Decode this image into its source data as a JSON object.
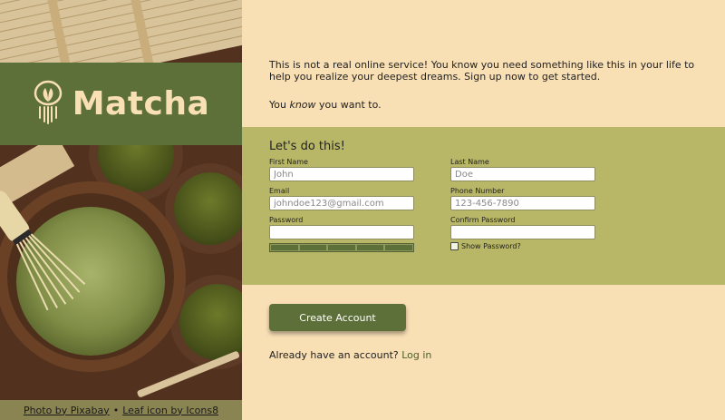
{
  "colors": {
    "page_bg": "#f9dfb4",
    "brand_green": "#5e703a",
    "form_band": "#b8b767",
    "credits_bar": "#8a8352"
  },
  "brand": {
    "name": "Matcha",
    "icon": "matcha-leaf-icon"
  },
  "credits": {
    "photo_link": "Photo by Pixabay",
    "separator": "•",
    "icon_link": "Leaf icon by Icons8"
  },
  "intro": {
    "line1": "This is not a real online service! You know you need something like this in your life to help you realize your deepest dreams. Sign up now to get started.",
    "line2_before": "You ",
    "line2_emphasis": "know",
    "line2_after": " you want to."
  },
  "form": {
    "title": "Let's do this!",
    "first_name": {
      "label": "First Name",
      "placeholder": "John"
    },
    "last_name": {
      "label": "Last Name",
      "placeholder": "Doe"
    },
    "email": {
      "label": "Email",
      "placeholder": "johndoe123@gmail.com"
    },
    "phone": {
      "label": "Phone Number",
      "placeholder": "123-456-7890"
    },
    "password": {
      "label": "Password",
      "placeholder": ""
    },
    "confirm_password": {
      "label": "Confirm Password",
      "placeholder": ""
    },
    "strength_segments": 5,
    "show_password_label": "Show Password?"
  },
  "actions": {
    "create_account": "Create Account",
    "login_prompt": "Already have an account? ",
    "login_link": "Log in"
  }
}
